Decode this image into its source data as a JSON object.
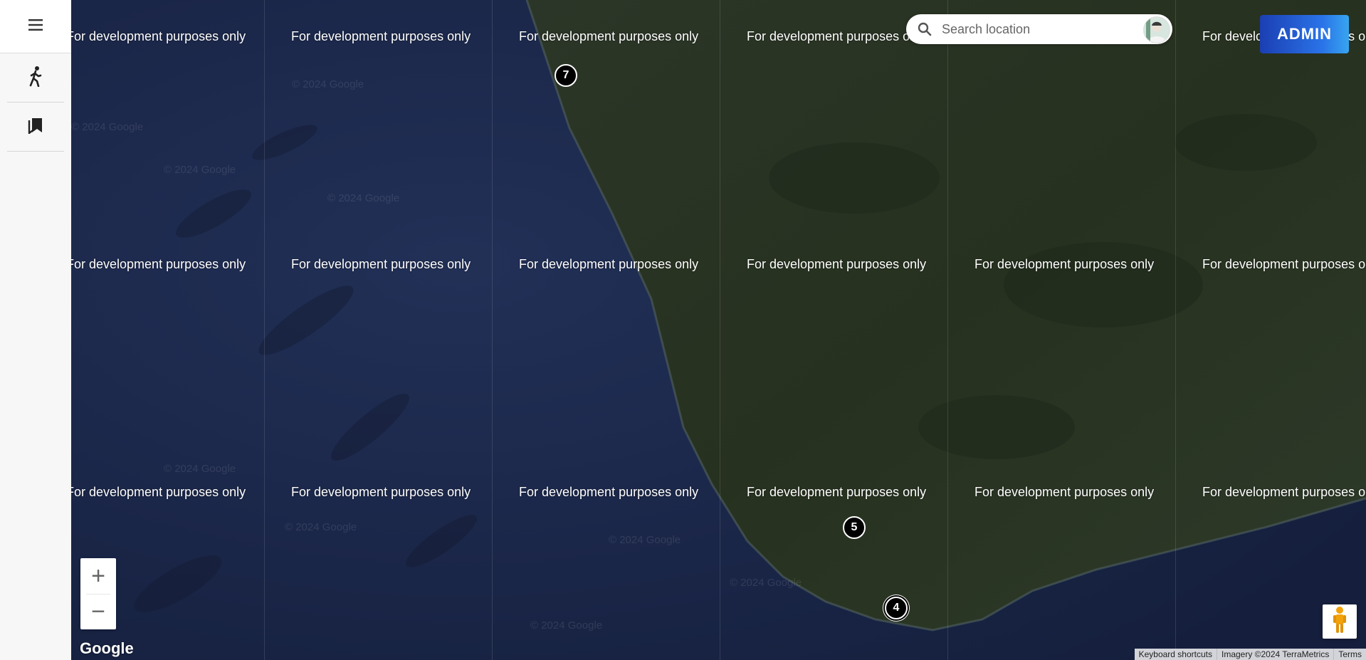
{
  "sidebar": {
    "menu_icon": "hamburger-menu-icon",
    "items": [
      {
        "icon": "walking-person-icon"
      },
      {
        "icon": "bookmarks-icon"
      }
    ]
  },
  "search": {
    "placeholder": "Search location",
    "value": "",
    "icon": "search-icon"
  },
  "admin_button": {
    "label": "ADMIN"
  },
  "watermark": {
    "text": "For development purposes only"
  },
  "faint_copyright": "© 2024 Google",
  "markers": [
    {
      "label": "7"
    },
    {
      "label": "5"
    },
    {
      "label": "4"
    }
  ],
  "zoom": {
    "in_label": "+",
    "out_label": "−"
  },
  "logo": {
    "text": "Google"
  },
  "attribution": {
    "keyboard_shortcuts": "Keyboard shortcuts",
    "imagery": "Imagery ©2024 TerraMetrics",
    "terms": "Terms"
  },
  "colors": {
    "ocean": "#1c2747",
    "land": "#2a3428",
    "admin_gradient_start": "#1b3fb3",
    "admin_gradient_end": "#37a5f0",
    "marker": "#000000"
  }
}
